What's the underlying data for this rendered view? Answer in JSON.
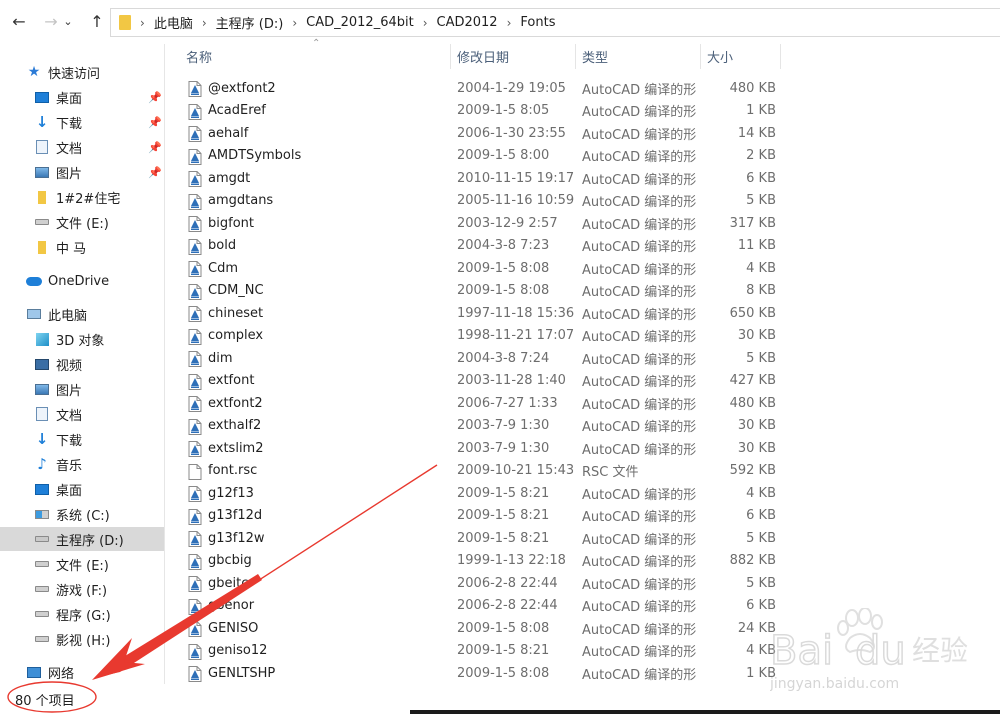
{
  "address": {
    "crumbs": [
      "此电脑",
      "主程序 (D:)",
      "CAD_2012_64bit",
      "CAD2012",
      "Fonts"
    ]
  },
  "sidebar": {
    "quick_access": "快速访问",
    "quick_items": [
      {
        "label": "桌面",
        "icon": "desktop-icon",
        "pinned": true
      },
      {
        "label": "下载",
        "icon": "download-icon",
        "pinned": true
      },
      {
        "label": "文档",
        "icon": "documents-icon",
        "pinned": true
      },
      {
        "label": "图片",
        "icon": "pictures-icon",
        "pinned": true
      },
      {
        "label": "1#2#住宅",
        "icon": "folder-icon",
        "pinned": false
      },
      {
        "label": "文件 (E:)",
        "icon": "drive-icon",
        "pinned": false
      },
      {
        "label": "中 马",
        "icon": "folder-icon",
        "pinned": false
      }
    ],
    "onedrive": "OneDrive",
    "this_pc": "此电脑",
    "pc_items": [
      {
        "label": "3D 对象",
        "icon": "3d-objects-icon"
      },
      {
        "label": "视频",
        "icon": "videos-icon"
      },
      {
        "label": "图片",
        "icon": "pictures-icon"
      },
      {
        "label": "文档",
        "icon": "documents-icon"
      },
      {
        "label": "下载",
        "icon": "download-icon"
      },
      {
        "label": "音乐",
        "icon": "music-icon"
      },
      {
        "label": "桌面",
        "icon": "desktop-icon"
      },
      {
        "label": "系统 (C:)",
        "icon": "system-drive-icon"
      },
      {
        "label": "主程序 (D:)",
        "icon": "drive-icon",
        "selected": true
      },
      {
        "label": "文件 (E:)",
        "icon": "drive-icon"
      },
      {
        "label": "游戏 (F:)",
        "icon": "drive-icon"
      },
      {
        "label": "程序 (G:)",
        "icon": "drive-icon"
      },
      {
        "label": "影视 (H:)",
        "icon": "drive-icon"
      }
    ],
    "network": "网络"
  },
  "columns": {
    "name": "名称",
    "date": "修改日期",
    "type": "类型",
    "size": "大小"
  },
  "files": [
    {
      "name": "@extfont2",
      "date": "2004-1-29 19:05",
      "type": "AutoCAD 编译的形",
      "size": "480 KB"
    },
    {
      "name": "AcadEref",
      "date": "2009-1-5 8:05",
      "type": "AutoCAD 编译的形",
      "size": "1 KB"
    },
    {
      "name": "aehalf",
      "date": "2006-1-30 23:55",
      "type": "AutoCAD 编译的形",
      "size": "14 KB"
    },
    {
      "name": "AMDTSymbols",
      "date": "2009-1-5 8:00",
      "type": "AutoCAD 编译的形",
      "size": "2 KB"
    },
    {
      "name": "amgdt",
      "date": "2010-11-15 19:17",
      "type": "AutoCAD 编译的形",
      "size": "6 KB"
    },
    {
      "name": "amgdtans",
      "date": "2005-11-16 10:59",
      "type": "AutoCAD 编译的形",
      "size": "5 KB"
    },
    {
      "name": "bigfont",
      "date": "2003-12-9 2:57",
      "type": "AutoCAD 编译的形",
      "size": "317 KB"
    },
    {
      "name": "bold",
      "date": "2004-3-8 7:23",
      "type": "AutoCAD 编译的形",
      "size": "11 KB"
    },
    {
      "name": "Cdm",
      "date": "2009-1-5 8:08",
      "type": "AutoCAD 编译的形",
      "size": "4 KB"
    },
    {
      "name": "CDM_NC",
      "date": "2009-1-5 8:08",
      "type": "AutoCAD 编译的形",
      "size": "8 KB"
    },
    {
      "name": "chineset",
      "date": "1997-11-18 15:36",
      "type": "AutoCAD 编译的形",
      "size": "650 KB"
    },
    {
      "name": "complex",
      "date": "1998-11-21 17:07",
      "type": "AutoCAD 编译的形",
      "size": "30 KB"
    },
    {
      "name": "dim",
      "date": "2004-3-8 7:24",
      "type": "AutoCAD 编译的形",
      "size": "5 KB"
    },
    {
      "name": "extfont",
      "date": "2003-11-28 1:40",
      "type": "AutoCAD 编译的形",
      "size": "427 KB"
    },
    {
      "name": "extfont2",
      "date": "2006-7-27 1:33",
      "type": "AutoCAD 编译的形",
      "size": "480 KB"
    },
    {
      "name": "exthalf2",
      "date": "2003-7-9 1:30",
      "type": "AutoCAD 编译的形",
      "size": "30 KB"
    },
    {
      "name": "extslim2",
      "date": "2003-7-9 1:30",
      "type": "AutoCAD 编译的形",
      "size": "30 KB"
    },
    {
      "name": "font.rsc",
      "date": "2009-10-21 15:43",
      "type": "RSC 文件",
      "size": "592 KB",
      "plain": true
    },
    {
      "name": "g12f13",
      "date": "2009-1-5 8:21",
      "type": "AutoCAD 编译的形",
      "size": "4 KB"
    },
    {
      "name": "g13f12d",
      "date": "2009-1-5 8:21",
      "type": "AutoCAD 编译的形",
      "size": "6 KB"
    },
    {
      "name": "g13f12w",
      "date": "2009-1-5 8:21",
      "type": "AutoCAD 编译的形",
      "size": "5 KB"
    },
    {
      "name": "gbcbig",
      "date": "1999-1-13 22:18",
      "type": "AutoCAD 编译的形",
      "size": "882 KB"
    },
    {
      "name": "gbeitc",
      "date": "2006-2-8 22:44",
      "type": "AutoCAD 编译的形",
      "size": "5 KB"
    },
    {
      "name": "gbenor",
      "date": "2006-2-8 22:44",
      "type": "AutoCAD 编译的形",
      "size": "6 KB"
    },
    {
      "name": "GENISO",
      "date": "2009-1-5 8:08",
      "type": "AutoCAD 编译的形",
      "size": "24 KB"
    },
    {
      "name": "geniso12",
      "date": "2009-1-5 8:21",
      "type": "AutoCAD 编译的形",
      "size": "4 KB"
    },
    {
      "name": "GENLTSHP",
      "date": "2009-1-5 8:08",
      "type": "AutoCAD 编译的形",
      "size": "1 KB"
    }
  ],
  "status": {
    "count_text": "80 个项目"
  },
  "watermark": {
    "brand": "Bai",
    "brand2": "du",
    "cn": "经验",
    "url": "jingyan.baidu.com"
  },
  "colors": {
    "selected_bg": "#cce8ff",
    "header_text": "#4c607a",
    "annotation_red": "#e8392f"
  }
}
